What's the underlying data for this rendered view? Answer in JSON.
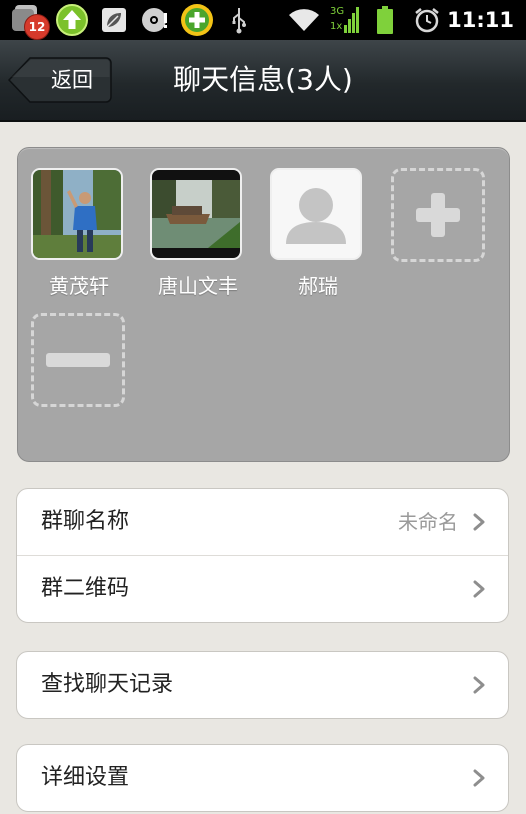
{
  "status_bar": {
    "notification_count": "12",
    "time": "11:11",
    "network_3g": "3G",
    "network_1x": "1x"
  },
  "title_bar": {
    "back_label": "返回",
    "title": "聊天信息(3人)"
  },
  "members": [
    {
      "name": "黄茂轩",
      "avatar": "photo-person-in-park"
    },
    {
      "name": "唐山文丰",
      "avatar": "photo-boat-on-lake"
    },
    {
      "name": "郝瑞",
      "avatar": "default-person-silhouette"
    }
  ],
  "actions": {
    "add_member": "plus-icon",
    "remove_member": "minus-icon"
  },
  "settings": {
    "group_name_label": "群聊名称",
    "group_name_value": "未命名",
    "qr_code_label": "群二维码",
    "search_history_label": "查找聊天记录",
    "detail_settings_label": "详细设置"
  },
  "colors": {
    "status_bar": "#000000",
    "title_bar": "#2b3235",
    "background": "#e9e7e2",
    "panel": "#a6a6a6",
    "badge": "#d63a2b"
  }
}
